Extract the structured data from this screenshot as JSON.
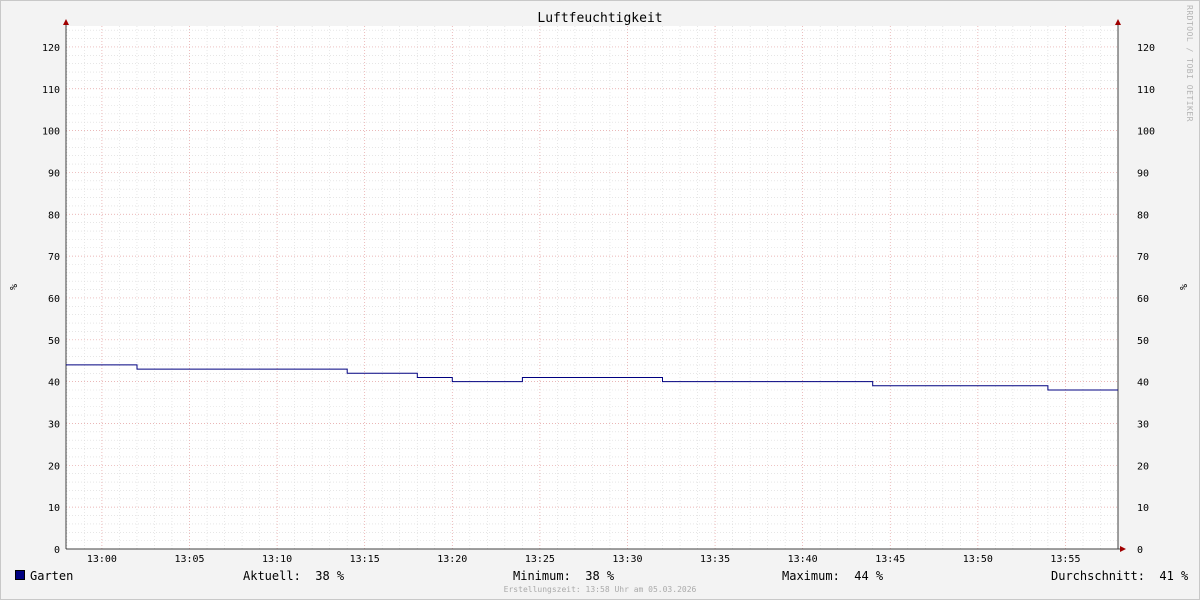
{
  "chart_data": {
    "type": "line",
    "title": "Luftfeuchtigkeit",
    "ylabel": "%",
    "ylabel_right": "%",
    "ylim": [
      0,
      125
    ],
    "y_ticks": [
      "0",
      "10",
      "20",
      "30",
      "40",
      "50",
      "60",
      "70",
      "80",
      "90",
      "100",
      "110",
      "120"
    ],
    "x_ticks": [
      "13:00",
      "13:05",
      "13:10",
      "13:15",
      "13:20",
      "13:25",
      "13:30",
      "13:35",
      "13:40",
      "13:45",
      "13:50",
      "13:55"
    ],
    "grid": true,
    "series": [
      {
        "name": "Garten",
        "color": "#000080",
        "x": [
          "12:58",
          "13:02",
          "13:02",
          "13:14",
          "13:14",
          "13:18",
          "13:18",
          "13:20",
          "13:20",
          "13:24",
          "13:24",
          "13:32",
          "13:32",
          "13:44",
          "13:44",
          "13:54",
          "13:54",
          "13:58"
        ],
        "values": [
          44,
          44,
          43,
          43,
          42,
          42,
          41,
          41,
          40,
          40,
          41,
          41,
          40,
          40,
          39,
          39,
          38,
          38
        ]
      }
    ]
  },
  "legend": {
    "series_name": "Garten",
    "series_color": "#000080",
    "aktuell": "Aktuell:  38 %",
    "minimum": "Minimum:  38 %",
    "maximum": "Maximum:  44 %",
    "durchschnitt": "Durchschnitt:  41 %"
  },
  "footer": "Erstellungszeit: 13:58 Uhr am 05.03.2026",
  "watermark": "RRDTOOL / TOBI OETIKER"
}
